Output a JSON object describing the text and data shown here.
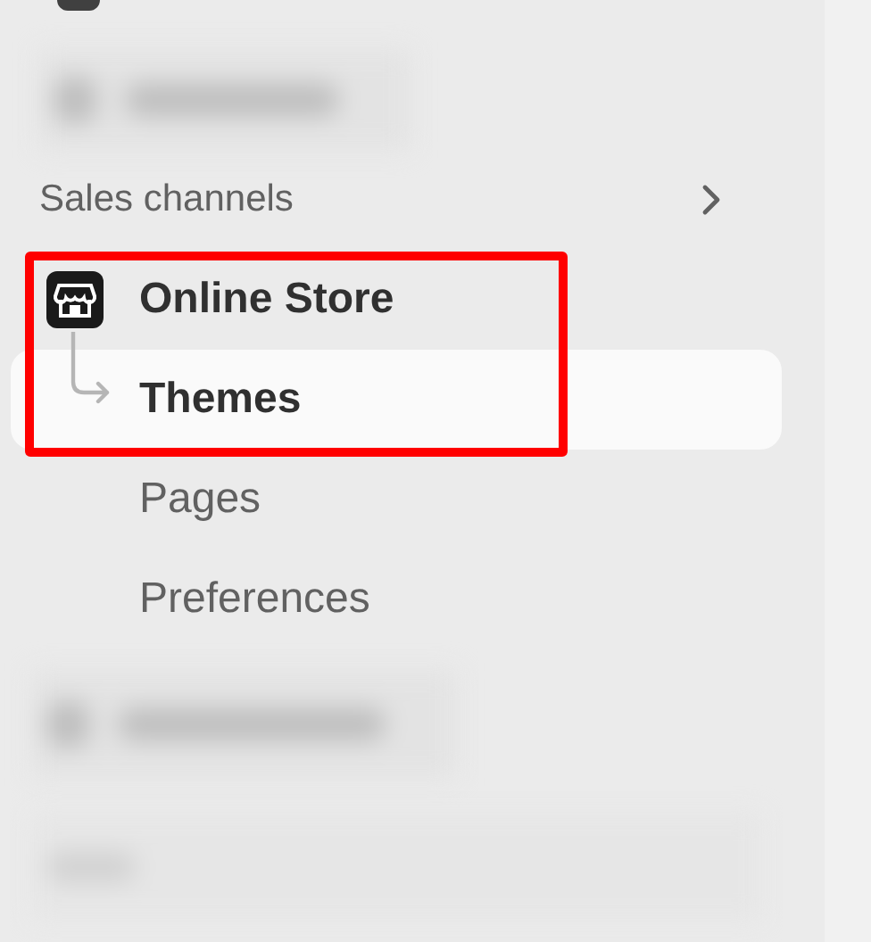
{
  "section": {
    "title": "Sales channels",
    "expandable": true
  },
  "channel": {
    "label": "Online Store",
    "highlighted": true,
    "children": [
      {
        "label": "Themes",
        "selected": true
      },
      {
        "label": "Pages",
        "selected": false
      },
      {
        "label": "Preferences",
        "selected": false
      }
    ]
  }
}
